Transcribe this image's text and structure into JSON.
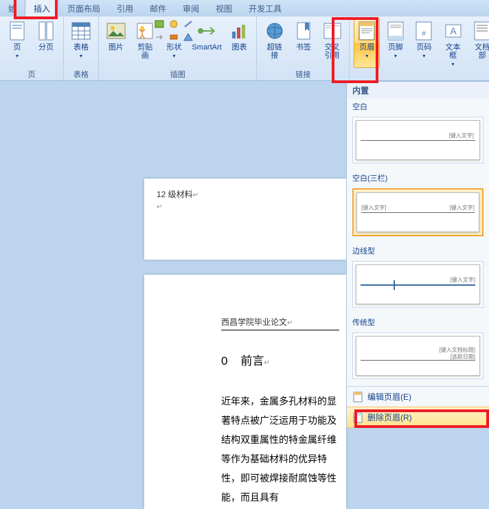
{
  "tabs": {
    "begin_partial": "始",
    "insert": "插入",
    "page_layout": "页面布局",
    "reference": "引用",
    "mail": "邮件",
    "review": "审阅",
    "view": "视图",
    "dev": "开发工具"
  },
  "ribbon": {
    "pages": {
      "group": "页",
      "page": "页",
      "section": "分页"
    },
    "tables": {
      "group": "表格",
      "table": "表格"
    },
    "illustrations": {
      "group": "插图",
      "picture": "图片",
      "clipart": "剪贴画",
      "shapes": "形状",
      "smartart": "SmartArt",
      "chart": "图表"
    },
    "links": {
      "group": "链接",
      "hyperlink": "超链接",
      "bookmark": "书签",
      "crossref": "交叉\n引用"
    },
    "hf": {
      "header": "页眉",
      "footer": "页脚",
      "pagenum": "页码"
    },
    "text": {
      "textbox": "文本框",
      "parts": "文档部"
    }
  },
  "doc": {
    "hdr1": "12 级材料",
    "hdr2": "西昌学院毕业论文",
    "h0_num": "0",
    "h0_title": "前言",
    "para": "        近年来，金属多孔材料的显著特点被广泛运用于功能及结构双重属性的特金属纤维等作为基础材料的优异特性，即可被焊接耐腐蚀等性能，而且具有"
  },
  "gallery": {
    "builtin": "内置",
    "blank": "空白",
    "blank3": "空白(三栏)",
    "border": "边线型",
    "trad": "传统型",
    "type_here": "[键入文字]",
    "type_title": "[键入文档标题]",
    "pick_date": "[选取日期]",
    "edit": "编辑页眉(E)",
    "remove": "删除页眉(R)"
  }
}
